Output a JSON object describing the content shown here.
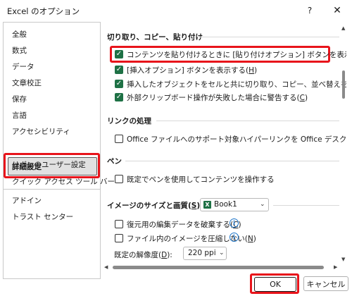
{
  "window": {
    "title": "Excel のオプション",
    "help": "?",
    "close": "✕"
  },
  "nav": {
    "items": [
      "全般",
      "数式",
      "データ",
      "文章校正",
      "保存",
      "言語",
      "アクセシビリティ",
      "詳細設定",
      "リボンのユーザー設定",
      "クイック アクセス ツール バー",
      "アドイン",
      "トラスト センター"
    ],
    "selected": "詳細設定"
  },
  "cut_copy_paste": {
    "title": "切り取り、コピー、貼り付け",
    "options": [
      {
        "text": "コンテンツを貼り付けるときに [貼り付けオプション] ボタンを表示する(",
        "key": "S",
        "end": ")",
        "checked": true
      },
      {
        "text": "[挿入オプション] ボタンを表示する(",
        "key": "H",
        "end": ")",
        "checked": true
      },
      {
        "text": "挿入したオブジェクトをセルと共に切り取り、コピー、並べ替えを行う(",
        "key": "O",
        "end": ")",
        "checked": true
      },
      {
        "text": "外部クリップボード操作が失敗した場合に警告する(",
        "key": "C",
        "end": ")",
        "checked": true
      }
    ]
  },
  "link_processing": {
    "title": "リンクの処理",
    "option": {
      "text": "Office ファイルへのサポート対象ハイパーリンクを Office デスクトップ アプリで",
      "checked": false
    }
  },
  "pen": {
    "title": "ペン",
    "option": {
      "text": "既定でペンを使用してコンテンツを操作する",
      "checked": false
    }
  },
  "image_size": {
    "title_prefix": "イメージのサイズと画質(",
    "title_key": "S",
    "title_end": ")",
    "workbook": "Book1",
    "xl_letter": "X",
    "options": [
      {
        "text": "復元用の編集データを破棄する(",
        "key": "C",
        "end": ")",
        "checked": false
      },
      {
        "text": "ファイル内のイメージを圧縮しない(",
        "key": "N",
        "end": ")",
        "checked": false
      }
    ],
    "resolution_prefix": "既定の解像度(",
    "resolution_key": "D",
    "resolution_end": "):",
    "resolution_value": "220 ppi",
    "info": "i"
  },
  "buttons": {
    "ok": "OK",
    "cancel": "キャンセル"
  },
  "colors": {
    "highlight": "#e8141b",
    "checkbox": "#1e7145",
    "info": "#1a73c8"
  }
}
